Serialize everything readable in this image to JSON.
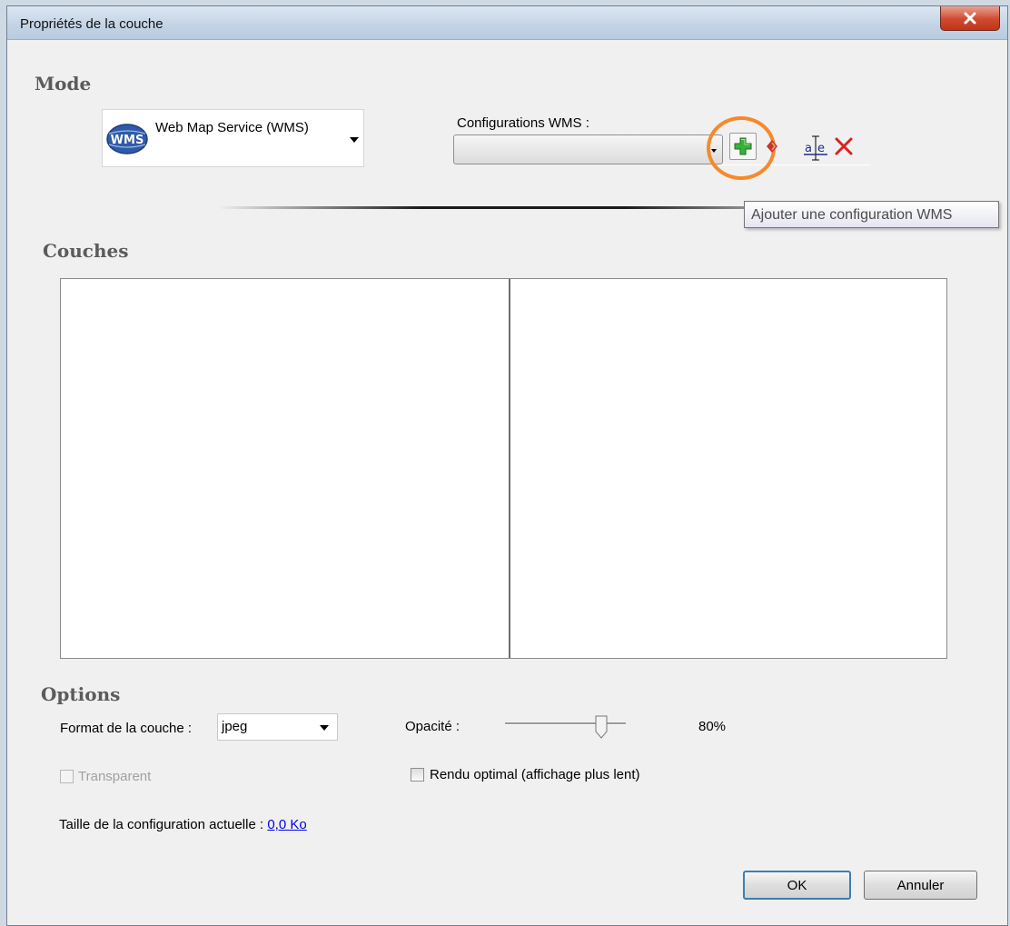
{
  "window": {
    "title": "Propriétés de la couche"
  },
  "mode": {
    "section_title": "Mode",
    "service_label": "Web Map Service (WMS)",
    "service_icon": "wms-globe-icon",
    "logo_text": "WMS"
  },
  "wms": {
    "configs_label": "Configurations WMS :",
    "selected_value": "",
    "add_tooltip": "Ajouter une configuration WMS",
    "highlight_color": "#f58a2b"
  },
  "layers": {
    "section_title": "Couches"
  },
  "options": {
    "section_title": "Options",
    "format_label": "Format de la couche :",
    "format_value": "jpeg",
    "opacity_label": "Opacité :",
    "opacity_value": "80%",
    "opacity_fraction": 0.8,
    "transparent_label": "Transparent",
    "transparent_checked": false,
    "optimal_render_label": "Rendu optimal (affichage plus lent)",
    "optimal_render_checked": false,
    "config_size_label": "Taille de la configuration actuelle :",
    "config_size_value": "0,0 Ko"
  },
  "buttons": {
    "ok": "OK",
    "cancel": "Annuler"
  }
}
